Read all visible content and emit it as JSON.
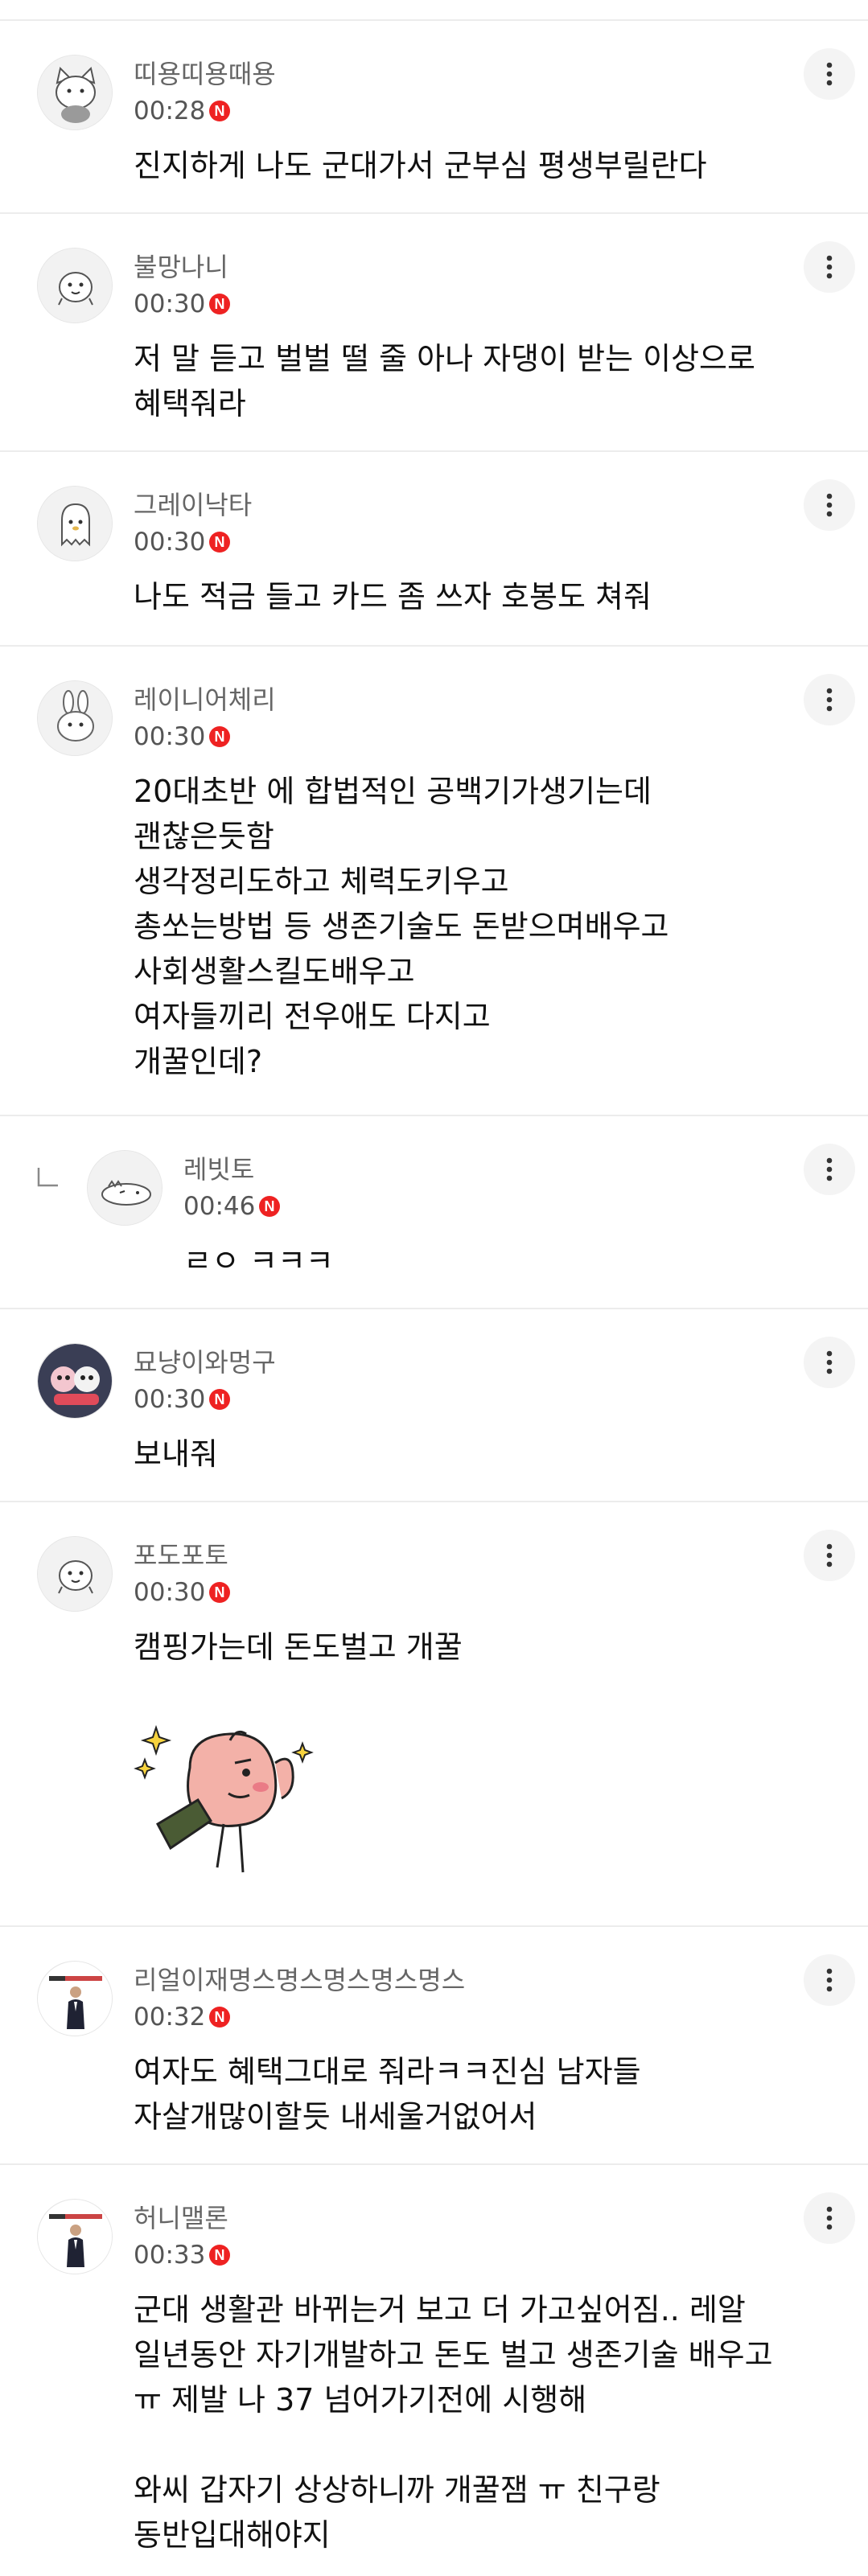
{
  "comments": [
    {
      "author": "띠용띠용때용",
      "time": "00:28",
      "badge": "N",
      "lines": [
        "진지하게 나도 군대가서 군부심 평생부릴란다"
      ]
    },
    {
      "author": "불망나니",
      "time": "00:30",
      "badge": "N",
      "lines": [
        "저 말 듣고 벌벌 떨 줄 아나 자댕이 받는 이상으로",
        "혜택줘라"
      ]
    },
    {
      "author": "그레이낙타",
      "time": "00:30",
      "badge": "N",
      "lines": [
        "나도 적금 들고 카드 좀 쓰자 호봉도 쳐줘"
      ]
    },
    {
      "author": "레이니어체리",
      "time": "00:30",
      "badge": "N",
      "lines": [
        "20대초반 에 합법적인 공백기가생기는데",
        "괜찮은듯함",
        "생각정리도하고 체력도키우고",
        "총쏘는방법 등 생존기술도 돈받으며배우고",
        "사회생활스킬도배우고",
        "여자들끼리 전우애도 다지고",
        "개꿀인데?"
      ]
    },
    {
      "author": "레빗토",
      "time": "00:46",
      "badge": "N",
      "lines": [
        "ㄹㅇ ㅋㅋㅋ"
      ],
      "is_reply": true
    },
    {
      "author": "묘냥이와멍구",
      "time": "00:30",
      "badge": "N",
      "lines": [
        "보내줘"
      ]
    },
    {
      "author": "포도포토",
      "time": "00:30",
      "badge": "N",
      "lines": [
        "캠핑가는데 돈도벌고 개꿀"
      ],
      "has_sticker": true
    },
    {
      "author": "리얼이재명스명스명스명스명스",
      "time": "00:32",
      "badge": "N",
      "lines": [
        "여자도 혜택그대로 줘라ㅋㅋ진심 남자들",
        "자살개많이할듯 내세울거없어서"
      ]
    },
    {
      "author": "허니맬론",
      "time": "00:33",
      "badge": "N",
      "lines": [
        "군대 생활관 바뀌는거 보고 더 가고싶어짐.. 레알",
        "일년동안 자기개발하고 돈도 벌고 생존기술 배우고",
        "ㅠ 제발 나 37 넘어가기전에 시행해",
        "",
        "와씨 갑자기 상상하니까 개꿀잼 ㅠ 친구랑",
        "동반입대해야지"
      ]
    }
  ],
  "icons": {
    "more": "more-vertical-icon",
    "reply": "reply-arrow-icon",
    "new": "new-badge-icon"
  },
  "colors": {
    "badge": "#ee2222",
    "author": "#666666",
    "divider": "#ececec"
  }
}
